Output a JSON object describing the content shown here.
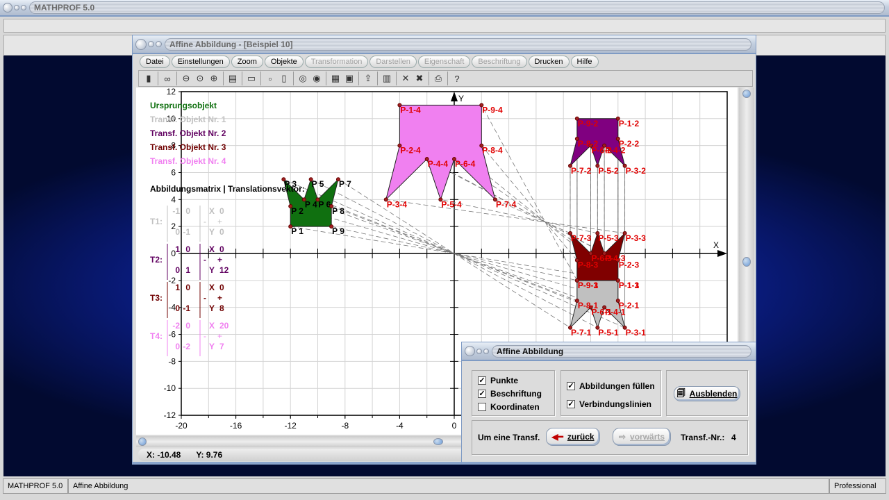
{
  "app": {
    "title": "MATHPROF 5.0"
  },
  "window": {
    "title": "Affine Abbildung - [Beispiel 10]"
  },
  "menu": [
    {
      "label": "Datei",
      "enabled": true
    },
    {
      "label": "Einstellungen",
      "enabled": true
    },
    {
      "label": "Zoom",
      "enabled": true
    },
    {
      "label": "Objekte",
      "enabled": true
    },
    {
      "label": "Transformation",
      "enabled": false
    },
    {
      "label": "Darstellen",
      "enabled": false
    },
    {
      "label": "Eigenschaft",
      "enabled": false
    },
    {
      "label": "Beschriftung",
      "enabled": false
    },
    {
      "label": "Drucken",
      "enabled": true
    },
    {
      "label": "Hilfe",
      "enabled": true
    }
  ],
  "toolbar": [
    {
      "icon": "window-icon",
      "glyph": "▮"
    },
    {
      "sep": true
    },
    {
      "icon": "glasses-icon",
      "glyph": "∞"
    },
    {
      "sep": true
    },
    {
      "icon": "zoom-out-icon",
      "glyph": "⊖"
    },
    {
      "icon": "zoom-reset-icon",
      "glyph": "⊙"
    },
    {
      "icon": "zoom-in-icon",
      "glyph": "⊕"
    },
    {
      "sep": true
    },
    {
      "icon": "properties-icon",
      "glyph": "▤"
    },
    {
      "sep": true
    },
    {
      "icon": "layout-icon",
      "glyph": "▭"
    },
    {
      "sep": true
    },
    {
      "icon": "point-icon",
      "glyph": "▫"
    },
    {
      "icon": "points-icon",
      "glyph": "▯"
    },
    {
      "sep": true
    },
    {
      "icon": "circle-1-icon",
      "glyph": "◎"
    },
    {
      "icon": "circle-2-icon",
      "glyph": "◉"
    },
    {
      "sep": true
    },
    {
      "icon": "table-icon",
      "glyph": "▦"
    },
    {
      "icon": "copy-image-icon",
      "glyph": "▣"
    },
    {
      "sep": true
    },
    {
      "icon": "export-icon",
      "glyph": "⇪"
    },
    {
      "sep": true
    },
    {
      "icon": "pages-icon",
      "glyph": "▥"
    },
    {
      "sep": true
    },
    {
      "icon": "delete-icon",
      "glyph": "✕"
    },
    {
      "icon": "delete-all-icon",
      "glyph": "✖"
    },
    {
      "sep": true
    },
    {
      "icon": "print-icon",
      "glyph": "⎙"
    },
    {
      "sep": true
    },
    {
      "icon": "help-icon",
      "glyph": "?"
    }
  ],
  "plot": {
    "xlim": [
      -20,
      20
    ],
    "ylim": [
      -12,
      12
    ],
    "x_ticks": [
      -20,
      -16,
      -12,
      -8,
      -4,
      0
    ],
    "y_ticks": [
      12,
      10,
      8,
      6,
      4,
      2,
      0,
      -2,
      -4,
      -6,
      -8,
      -10,
      -12
    ],
    "x_axis_label": "X",
    "y_axis_label": "Y",
    "legend": [
      {
        "label": "Ursprungsobjekt",
        "color": "#107010"
      },
      {
        "label": "Transf. Objekt Nr. 1",
        "color": "#c0c0c0"
      },
      {
        "label": "Transf. Objekt Nr. 2",
        "color": "#600060"
      },
      {
        "label": "Transf. Objekt Nr. 3",
        "color": "#700000"
      },
      {
        "label": "Transf. Objekt Nr. 4",
        "color": "#f080f0"
      }
    ],
    "matrix_heading": "Abbildungsmatrix | Translationsvektor:",
    "original_points": [
      {
        "name": "P 1",
        "x": -12,
        "y": 2
      },
      {
        "name": "P 2",
        "x": -12,
        "y": 3.5
      },
      {
        "name": "P 3",
        "x": -12.5,
        "y": 5.5
      },
      {
        "name": "P 4",
        "x": -11,
        "y": 4
      },
      {
        "name": "P 5",
        "x": -10.5,
        "y": 5.5
      },
      {
        "name": "P 6",
        "x": -10,
        "y": 4
      },
      {
        "name": "P 7",
        "x": -8.5,
        "y": 5.5
      },
      {
        "name": "P 8",
        "x": -9,
        "y": 3.5
      },
      {
        "name": "P 9",
        "x": -9,
        "y": 2
      }
    ],
    "original_fill": "#107010",
    "transformations": [
      {
        "label": "T1:",
        "matrix": [
          [
            -1,
            0
          ],
          [
            0,
            -1
          ]
        ],
        "vector": [
          0,
          0
        ],
        "fill": "#c0c0c0",
        "text_color": "#c0c0c0"
      },
      {
        "label": "T2:",
        "matrix": [
          [
            1,
            0
          ],
          [
            0,
            1
          ]
        ],
        "vector": [
          0,
          12
        ],
        "fill": "#800080",
        "text_color": "#600060"
      },
      {
        "label": "T3:",
        "matrix": [
          [
            1,
            0
          ],
          [
            0,
            -1
          ]
        ],
        "vector": [
          0,
          8
        ],
        "fill": "#800000",
        "text_color": "#700000"
      },
      {
        "label": "T4:",
        "matrix": [
          [
            -2,
            0
          ],
          [
            0,
            -2
          ]
        ],
        "vector": [
          20,
          7
        ],
        "fill": "#f080f0",
        "text_color": "#f080f0"
      }
    ],
    "vector_labels": [
      "X",
      "Y"
    ],
    "point_label_color": "#e00000"
  },
  "coords": {
    "x": "X: -10.48",
    "y": "Y: 9.76"
  },
  "dialog": {
    "title": "Affine Abbildung",
    "checkboxes": [
      {
        "label": "Punkte",
        "checked": true
      },
      {
        "label": "Beschriftung",
        "checked": true
      },
      {
        "label": "Koordinaten",
        "checked": false
      }
    ],
    "checkboxes2": [
      {
        "label": "Abbildungen füllen",
        "checked": true
      },
      {
        "label": "Verbindungslinien",
        "checked": true
      }
    ],
    "hide_button": "Ausblenden",
    "step_label": "Um eine Transf.",
    "back_button": "zurück",
    "forward_button": "vorwärts",
    "transf_nr_label": "Transf.-Nr.:",
    "transf_nr": "4"
  },
  "statusbar": {
    "app": "MATHPROF 5.0",
    "module": "Affine Abbildung",
    "edition": "Professional"
  }
}
